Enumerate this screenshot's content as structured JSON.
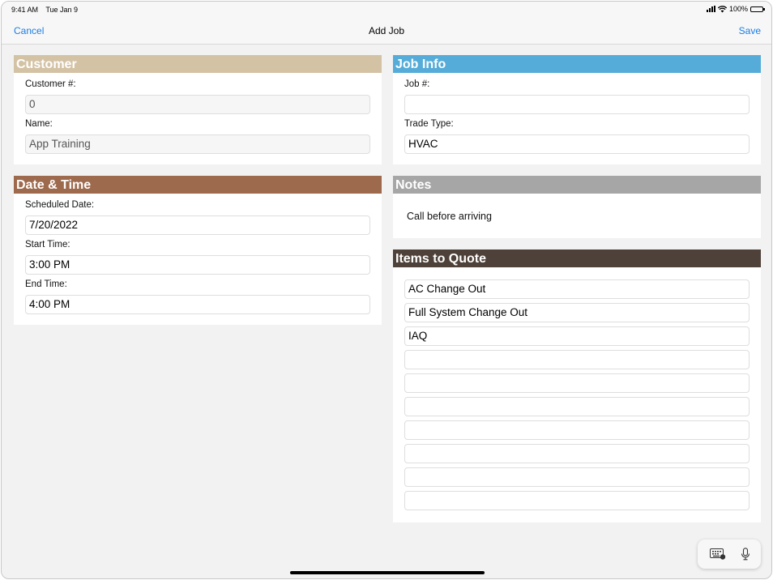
{
  "status_bar": {
    "time": "9:41 AM",
    "date": "Tue Jan 9",
    "battery": "100%"
  },
  "nav": {
    "cancel": "Cancel",
    "title": "Add Job",
    "save": "Save"
  },
  "customer": {
    "header": "Customer",
    "number_label": "Customer #:",
    "number_value": "0",
    "name_label": "Name:",
    "name_value": "App Training",
    "header_color": "#d4c2a4"
  },
  "job_info": {
    "header": "Job Info",
    "job_label": "Job #:",
    "job_value": "",
    "trade_label": "Trade Type:",
    "trade_value": "HVAC",
    "header_color": "#55acd8"
  },
  "date_time": {
    "header": "Date & Time",
    "scheduled_label": "Scheduled Date:",
    "scheduled_value": "7/20/2022",
    "start_label": "Start Time:",
    "start_value": "3:00 PM",
    "end_label": "End Time:",
    "end_value": "4:00 PM",
    "header_color": "#9e6a4e"
  },
  "notes": {
    "header": "Notes",
    "text": "Call before arriving",
    "header_color": "#a6a6a6"
  },
  "items": {
    "header": "Items to Quote",
    "header_color": "#4e4139",
    "values": [
      "AC Change Out",
      "Full System Change Out",
      "IAQ",
      "",
      "",
      "",
      "",
      "",
      "",
      ""
    ]
  },
  "icons": {
    "keyboard": "keyboard-icon",
    "mic": "microphone-icon"
  }
}
